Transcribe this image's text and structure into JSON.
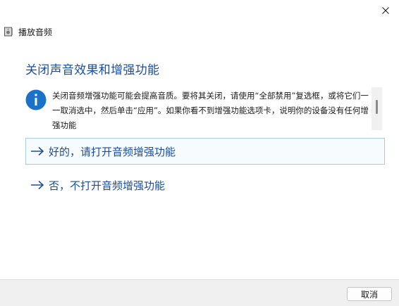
{
  "window": {
    "title": "播放音频",
    "app_icon": "speaker-device-icon",
    "close_icon": "close-icon"
  },
  "main": {
    "heading": "关闭声音效果和增强功能",
    "info": {
      "icon": "info-icon",
      "text": "关闭音频增强功能可能会提高音质。要将其关闭，请使用“全部禁用”复选框，或将它们一一取消选中，然后单击“应用”。如果你看不到增强功能选项卡，说明你的设备没有任何增强功能"
    },
    "options": [
      {
        "label": "好的，请打开音频增强功能",
        "icon": "arrow-right-icon"
      },
      {
        "label": "否，不打开音频增强功能",
        "icon": "arrow-right-icon"
      }
    ]
  },
  "footer": {
    "cancel_label": "取消"
  },
  "colors": {
    "accent": "#1a4ea1",
    "info_icon_bg": "#1a73c8",
    "focus_border": "#a9cde8",
    "footer_bg": "#f0f0f0"
  }
}
